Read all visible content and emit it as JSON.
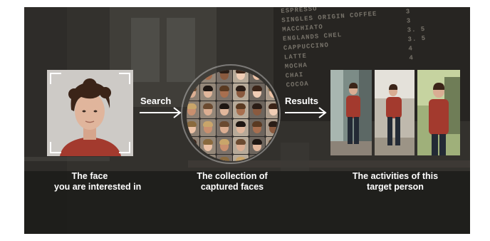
{
  "menu_board": {
    "items": [
      {
        "name": "ESPRESSO",
        "price": "3."
      },
      {
        "name": "SINGLES ORIGIN COFFEE",
        "price": "3"
      },
      {
        "name": "MACCHIATO",
        "price": "3"
      },
      {
        "name": "ENGLANDS CHEL",
        "price": "3. 5"
      },
      {
        "name": "CAPPUCCINO",
        "price": "3. 5"
      },
      {
        "name": "LATTE",
        "price": "4"
      },
      {
        "name": "MOCHA",
        "price": "4"
      },
      {
        "name": "CHAI",
        "price": ""
      },
      {
        "name": "COCOA",
        "price": ""
      }
    ]
  },
  "steps": {
    "query": {
      "caption_line1": "The face",
      "caption_line2": "you are interested in"
    },
    "search_label": "Search",
    "collection": {
      "caption_line1": "The collection of",
      "caption_line2": "captured faces"
    },
    "results_label": "Results",
    "results": {
      "caption_line1": "The activities of this",
      "caption_line2": "target person"
    }
  },
  "colors": {
    "text": "#ffffff",
    "sweater": "#a33a2e",
    "query_background": "#c9c6c2"
  }
}
